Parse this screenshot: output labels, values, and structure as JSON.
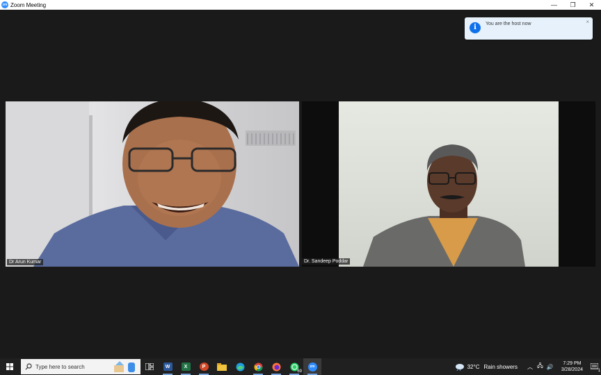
{
  "window": {
    "title": "Zoom Meeting",
    "logo_text": "zm"
  },
  "controls": {
    "minimize": "—",
    "restore": "❐",
    "close": "✕"
  },
  "notification": {
    "text": "You are the host now",
    "icon": "i",
    "close": "×"
  },
  "participants": [
    {
      "name": "Dr Arun Kumar"
    },
    {
      "name": "Dr. Sandeep Poddar"
    }
  ],
  "taskbar": {
    "search_placeholder": "Type here to search",
    "apps": [
      "task-view",
      "word",
      "excel",
      "powerpoint",
      "file-explorer",
      "edge",
      "chrome",
      "firefox",
      "whatsapp",
      "zoom"
    ],
    "whatsapp_badge": "69",
    "zoom_label": "zm",
    "word_label": "W",
    "excel_label": "X",
    "ppt_label": "P",
    "weather": {
      "temp": "32°C",
      "desc": "Rain showers"
    },
    "time": "7:29 PM",
    "date": "3/28/2024",
    "notif_count": "1"
  }
}
